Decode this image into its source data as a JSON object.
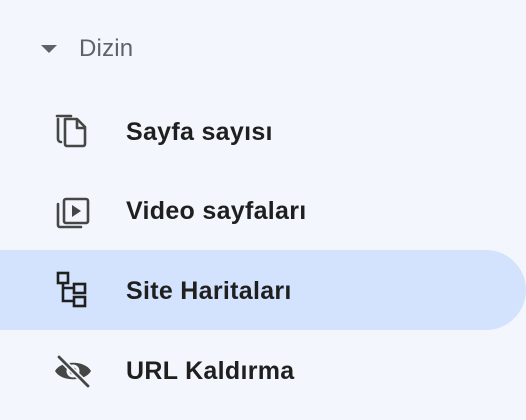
{
  "section": {
    "label": "Dizin",
    "expanded": true,
    "caret_icon": "arrow-drop-down-icon"
  },
  "items": [
    {
      "label": "Sayfa sayısı",
      "icon": "copy-pages-icon",
      "selected": false
    },
    {
      "label": "Video sayfaları",
      "icon": "video-pages-icon",
      "selected": false
    },
    {
      "label": "Site Haritaları",
      "icon": "sitemap-icon",
      "selected": true
    },
    {
      "label": "URL Kaldırma",
      "icon": "visibility-off-icon",
      "selected": false
    }
  ],
  "colors": {
    "background": "#f3f6fc",
    "selected_background": "#d3e3fd",
    "text": "#1f1f1f",
    "muted": "#5f6368",
    "icon": "#444746"
  }
}
